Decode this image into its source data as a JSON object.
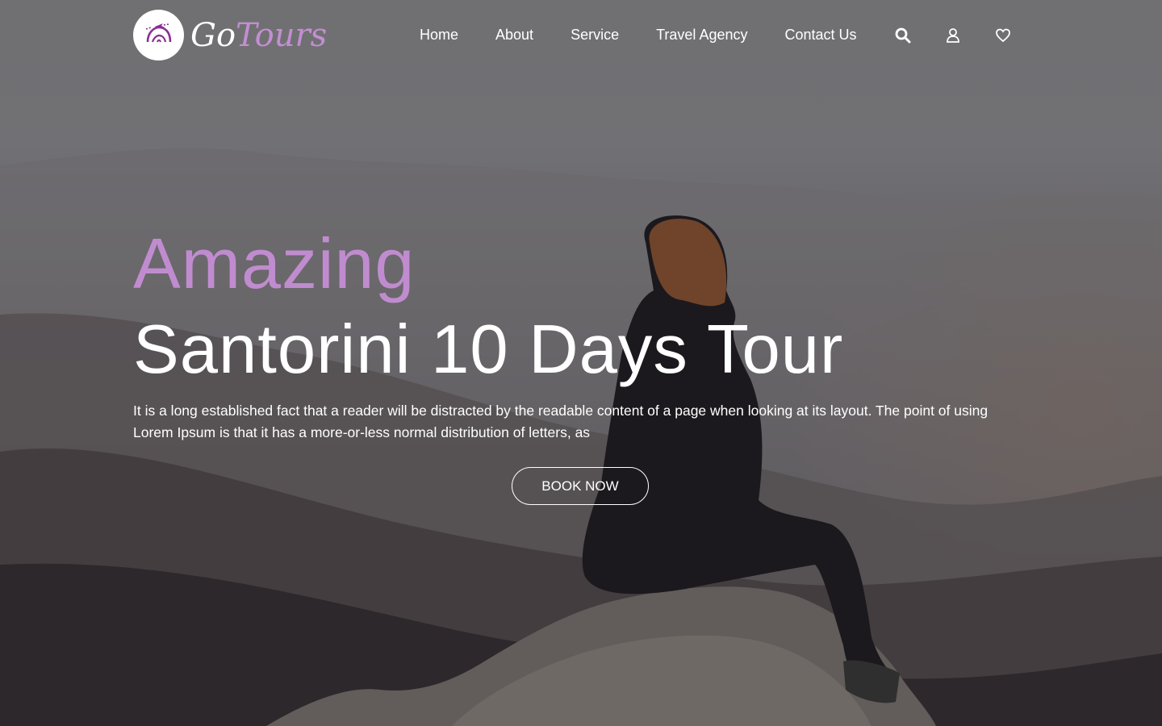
{
  "brand": {
    "go": "Go",
    "tours": "Tours",
    "accent": "#c08ccf"
  },
  "nav": {
    "items": [
      {
        "label": "Home"
      },
      {
        "label": "About"
      },
      {
        "label": "Service"
      },
      {
        "label": "Travel Agency"
      },
      {
        "label": "Contact Us"
      }
    ],
    "icons": [
      "search-icon",
      "user-icon",
      "heart-icon"
    ]
  },
  "hero": {
    "kicker": "Amazing",
    "title": "Santorini 10 Days Tour",
    "description": "It is a long established fact that a reader will be distracted by the readable content of a page when looking at its layout. The point of using Lorem Ipsum is that it has a more-or-less normal distribution of letters, as",
    "cta": "BOOK NOW"
  }
}
